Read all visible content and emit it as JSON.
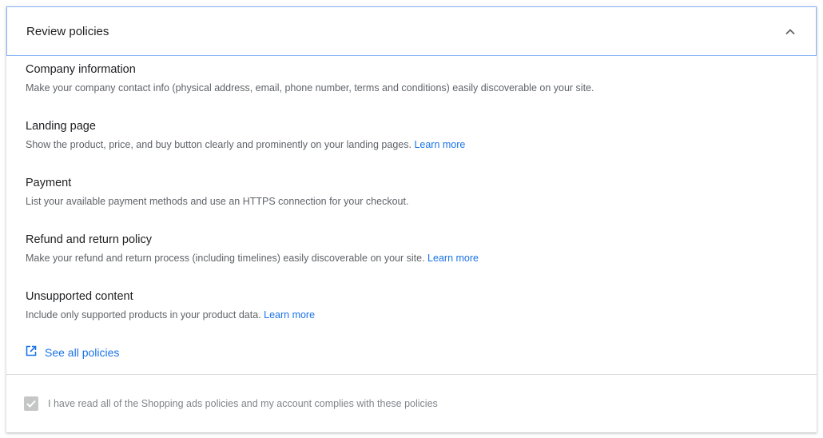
{
  "header": {
    "title": "Review policies",
    "toggle_icon": "chevron-up-icon"
  },
  "policies": [
    {
      "title": "Company information",
      "description": "Make your company contact info (physical address, email, phone number, terms and conditions) easily discoverable on your site.",
      "link": ""
    },
    {
      "title": "Landing page",
      "description": "Show the product, price, and buy button clearly and prominently on your landing pages.",
      "link": "Learn more"
    },
    {
      "title": "Payment",
      "description": "List your available payment methods and use an HTTPS connection for your checkout.",
      "link": ""
    },
    {
      "title": "Refund and return policy",
      "description": "Make your refund and return process (including timelines) easily discoverable on your site.",
      "link": "Learn more"
    },
    {
      "title": "Unsupported content",
      "description": "Include only supported products in your product data.",
      "link": "Learn more"
    }
  ],
  "see_all": {
    "label": "See all policies",
    "icon": "open-in-new-icon"
  },
  "agreement": {
    "label": "I have read all of the Shopping ads policies and my account complies with these policies",
    "checked": true,
    "disabled": true
  },
  "colors": {
    "link": "#1a73e8",
    "header_border": "#8ab4f8",
    "checkbox_disabled": "#c4c7c5"
  }
}
